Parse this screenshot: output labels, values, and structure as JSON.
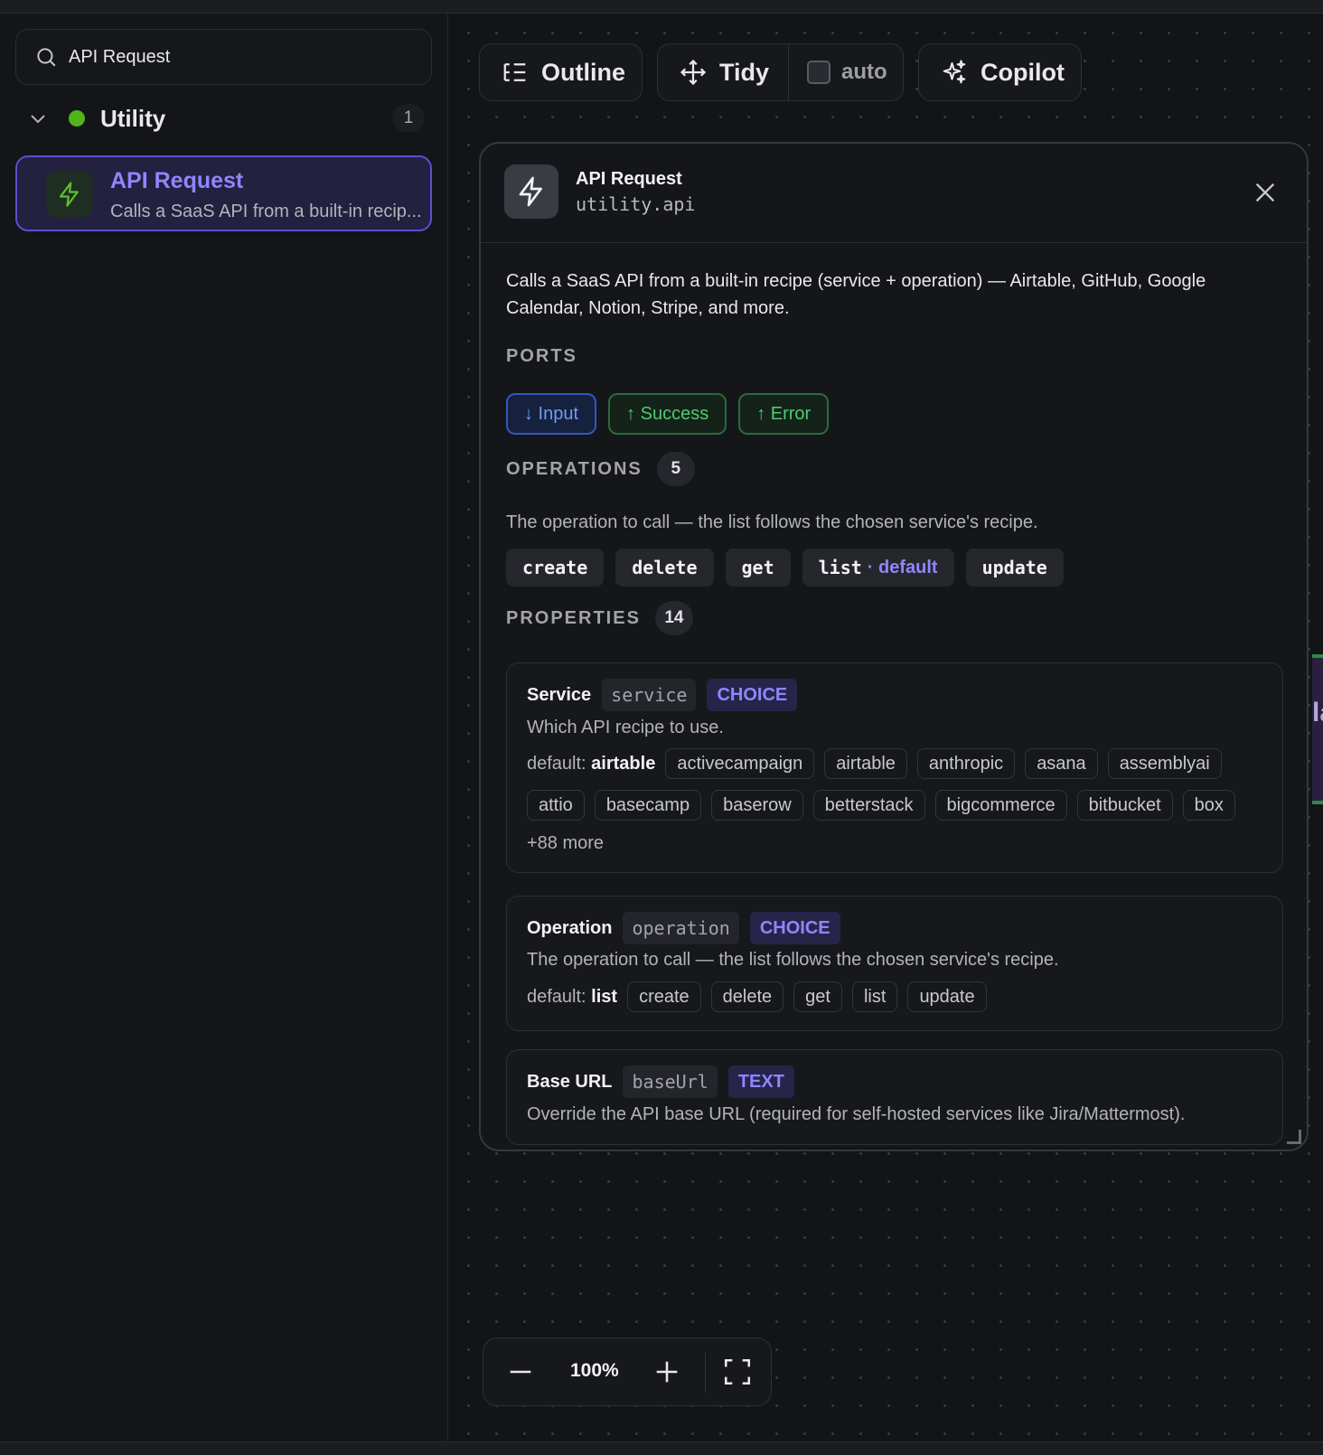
{
  "sidebar": {
    "search": {
      "value": "API Request",
      "icon": "search-icon"
    },
    "group": {
      "name": "Utility",
      "count": "1",
      "status_color": "#4fb51d"
    },
    "item": {
      "title": "API Request",
      "description": "Calls a SaaS API from a built-in recip...",
      "icon": "lightning-icon"
    }
  },
  "toolbar": {
    "outline_label": "Outline",
    "tidy_label": "Tidy",
    "auto_label": "auto",
    "copilot_label": "Copilot"
  },
  "panel": {
    "title": "API Request",
    "id": "utility.api",
    "description": "Calls a SaaS API from a built-in recipe (service + operation) — Airtable, GitHub, Google Calendar, Notion, Stripe, and more.",
    "ports_heading": "PORTS",
    "ports": [
      "↓ Input",
      "↑ Success",
      "↑ Error"
    ],
    "operations_heading": "OPERATIONS",
    "operations_count": "5",
    "operations_desc": "The operation to call — the list follows the chosen service's recipe.",
    "operations": [
      "create",
      "delete",
      "get",
      "list",
      "update"
    ],
    "operations_default_suffix": "· default",
    "properties_heading": "PROPERTIES",
    "properties_count": "14",
    "properties": [
      {
        "name": "Service",
        "key": "service",
        "type": "CHOICE",
        "desc": "Which API recipe to use.",
        "default_label": "default:",
        "default_value": "airtable",
        "options": [
          "activecampaign",
          "airtable",
          "anthropic",
          "asana",
          "assemblyai",
          "attio",
          "basecamp",
          "baserow",
          "betterstack",
          "bigcommerce",
          "bitbucket",
          "box"
        ],
        "more": "+88 more"
      },
      {
        "name": "Operation",
        "key": "operation",
        "type": "CHOICE",
        "desc": "The operation to call — the list follows the chosen service's recipe.",
        "default_label": "default:",
        "default_value": "list",
        "options": [
          "create",
          "delete",
          "get",
          "list",
          "update"
        ]
      },
      {
        "name": "Base URL",
        "key": "baseUrl",
        "type": "TEXT",
        "desc": "Override the API base URL (required for self-hosted services like Jira/Mattermost)."
      }
    ]
  },
  "edge_node": {
    "text": "la"
  },
  "zoom": {
    "level": "100%"
  },
  "colors": {
    "accent": "#8f86ff",
    "success": "#4ecb6f",
    "input": "#6e9cf5",
    "background": "#131416"
  }
}
